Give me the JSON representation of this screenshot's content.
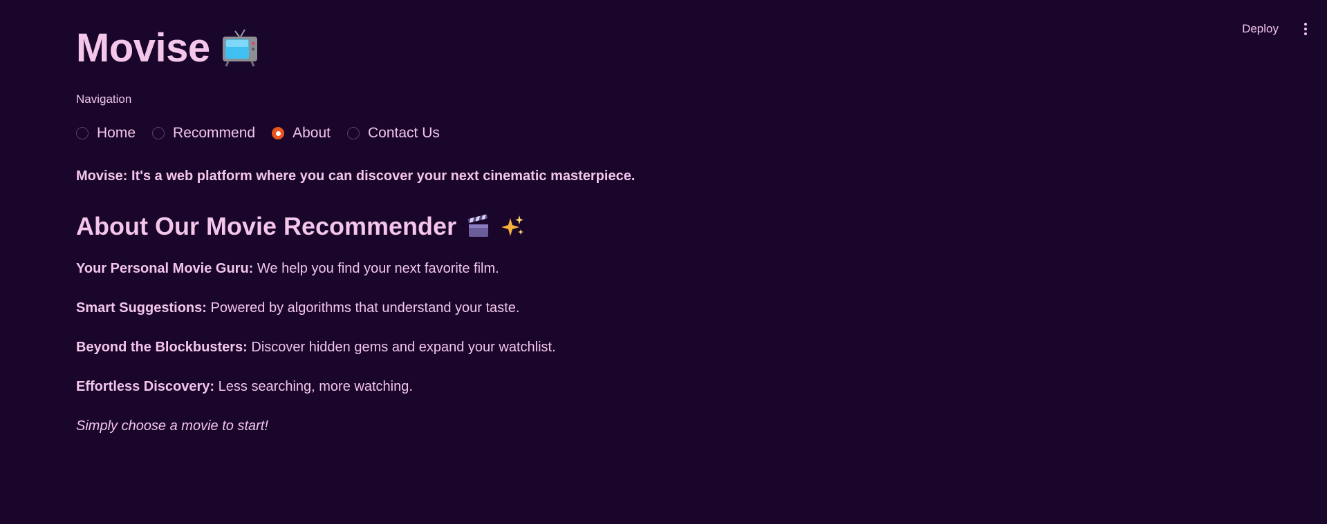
{
  "header": {
    "deploy_label": "Deploy",
    "menu_icon": "more-vertical-icon"
  },
  "app": {
    "title": "Movise",
    "title_icon": "tv-icon"
  },
  "navigation": {
    "label": "Navigation",
    "options": [
      {
        "label": "Home",
        "selected": false
      },
      {
        "label": "Recommend",
        "selected": false
      },
      {
        "label": "About",
        "selected": true
      },
      {
        "label": "Contact Us",
        "selected": false
      }
    ],
    "selected_color": "#e8561f"
  },
  "content": {
    "intro": "Movise: It's a web platform where you can discover your next cinematic masterpiece.",
    "heading": "About Our Movie Recommender",
    "heading_icons": [
      "clapper-board-icon",
      "sparkles-icon"
    ],
    "features": [
      {
        "title": "Your Personal Movie Guru:",
        "text": " We help you find your next favorite film."
      },
      {
        "title": "Smart Suggestions:",
        "text": " Powered by algorithms that understand your taste."
      },
      {
        "title": "Beyond the Blockbusters:",
        "text": " Discover hidden gems and expand your watchlist."
      },
      {
        "title": "Effortless Discovery:",
        "text": " Less searching, more watching."
      }
    ],
    "cta": "Simply choose a movie to start!"
  },
  "colors": {
    "background": "#1a052b",
    "text": "#f3c6ea",
    "accent": "#e8561f"
  }
}
